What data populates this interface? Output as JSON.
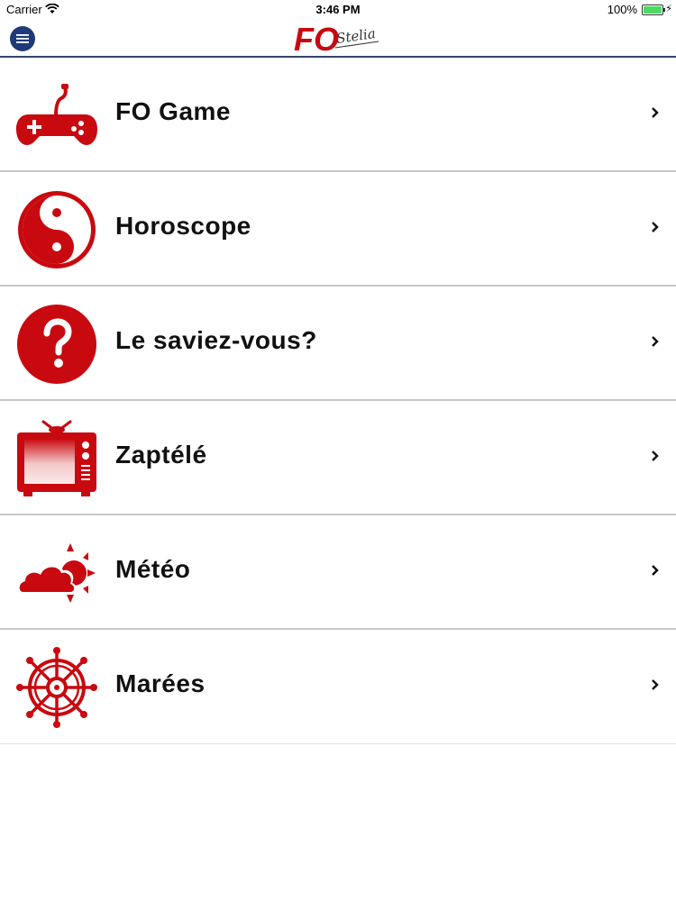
{
  "status_bar": {
    "carrier": "Carrier",
    "time": "3:46 PM",
    "battery": "100%"
  },
  "nav": {
    "logo_primary": "FO",
    "logo_secondary": "Stelia"
  },
  "menu": [
    {
      "label": "FO Game",
      "icon": "gamepad-icon"
    },
    {
      "label": "Horoscope",
      "icon": "yin-yang-icon"
    },
    {
      "label": "Le saviez-vous?",
      "icon": "question-icon"
    },
    {
      "label": "Zaptélé",
      "icon": "tv-icon"
    },
    {
      "label": "Météo",
      "icon": "weather-icon"
    },
    {
      "label": "Marées",
      "icon": "ship-wheel-icon"
    }
  ],
  "colors": {
    "icon_red": "#c8090f",
    "nav_blue": "#1f3a7a",
    "divider": "#c8c8c8"
  }
}
